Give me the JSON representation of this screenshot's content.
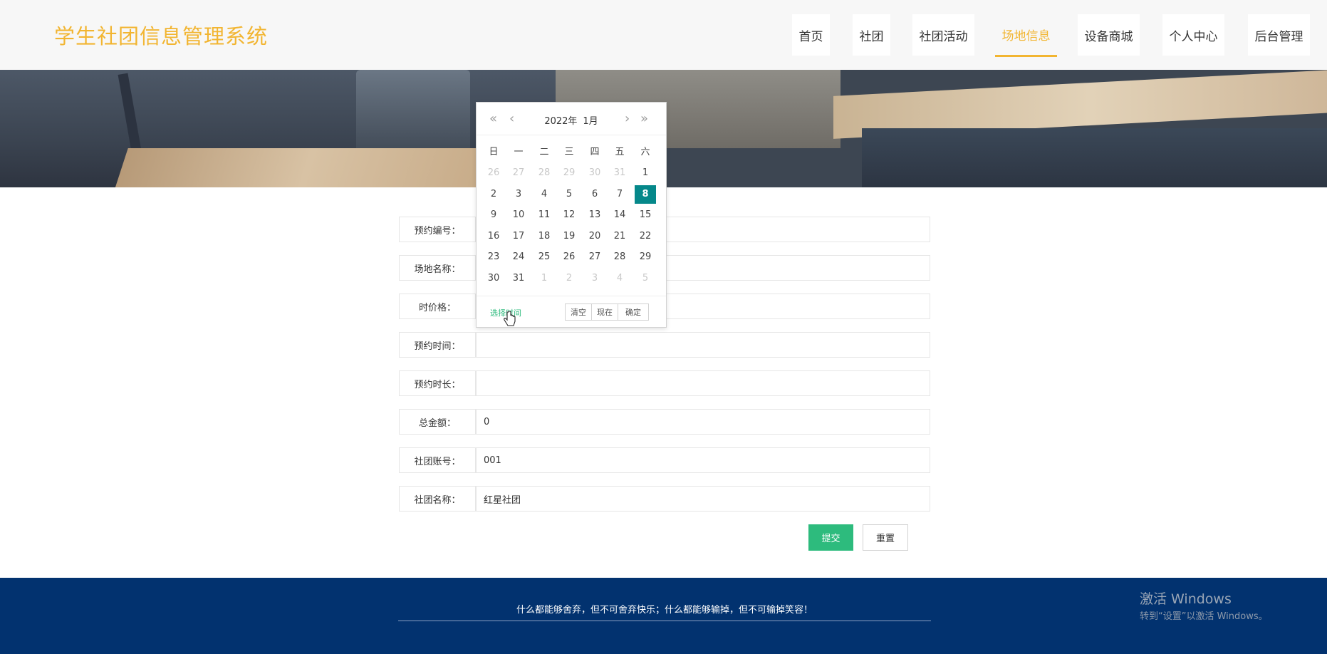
{
  "app": {
    "title": "学生社团信息管理系统"
  },
  "nav": [
    {
      "label": "首页",
      "active": false
    },
    {
      "label": "社团",
      "active": false
    },
    {
      "label": "社团活动",
      "active": false
    },
    {
      "label": "场地信息",
      "active": true
    },
    {
      "label": "设备商城",
      "active": false
    },
    {
      "label": "个人中心",
      "active": false
    },
    {
      "label": "后台管理",
      "active": false
    }
  ],
  "form": {
    "fields": [
      {
        "label": "预约编号：",
        "value": ""
      },
      {
        "label": "场地名称：",
        "value": ""
      },
      {
        "label": "时价格：",
        "value": ""
      },
      {
        "label": "预约时间：",
        "value": ""
      },
      {
        "label": "预约时长：",
        "value": ""
      },
      {
        "label": "总金额：",
        "value": "0"
      },
      {
        "label": "社团账号：",
        "value": "001"
      },
      {
        "label": "社团名称：",
        "value": "红星社团"
      }
    ],
    "submit_label": "提交",
    "reset_label": "重置"
  },
  "datepicker": {
    "year": "2022年",
    "month": "1月",
    "weekdays": [
      "日",
      "一",
      "二",
      "三",
      "四",
      "五",
      "六"
    ],
    "days": [
      "26",
      "27",
      "28",
      "29",
      "30",
      "31",
      "1",
      "2",
      "3",
      "4",
      "5",
      "6",
      "7",
      "8",
      "9",
      "10",
      "11",
      "12",
      "13",
      "14",
      "15",
      "16",
      "17",
      "18",
      "19",
      "20",
      "21",
      "22",
      "23",
      "24",
      "25",
      "26",
      "27",
      "28",
      "29",
      "30",
      "31",
      "1",
      "2",
      "3",
      "4",
      "5"
    ],
    "selected_day": "8",
    "select_time_label": "选择时间",
    "clear_label": "清空",
    "now_label": "现在",
    "confirm_label": "确定"
  },
  "footer": {
    "text": "什么都能够舍弃，但不可舍弃快乐；什么都能够输掉，但不可输掉笑容！"
  },
  "watermark": {
    "line1": "激活 Windows",
    "line2": "转到“设置”以激活 Windows。"
  },
  "colors": {
    "accent": "#f2b531",
    "primary": "#2dbb7d",
    "selected": "#05888a",
    "footer": "#02326f"
  }
}
